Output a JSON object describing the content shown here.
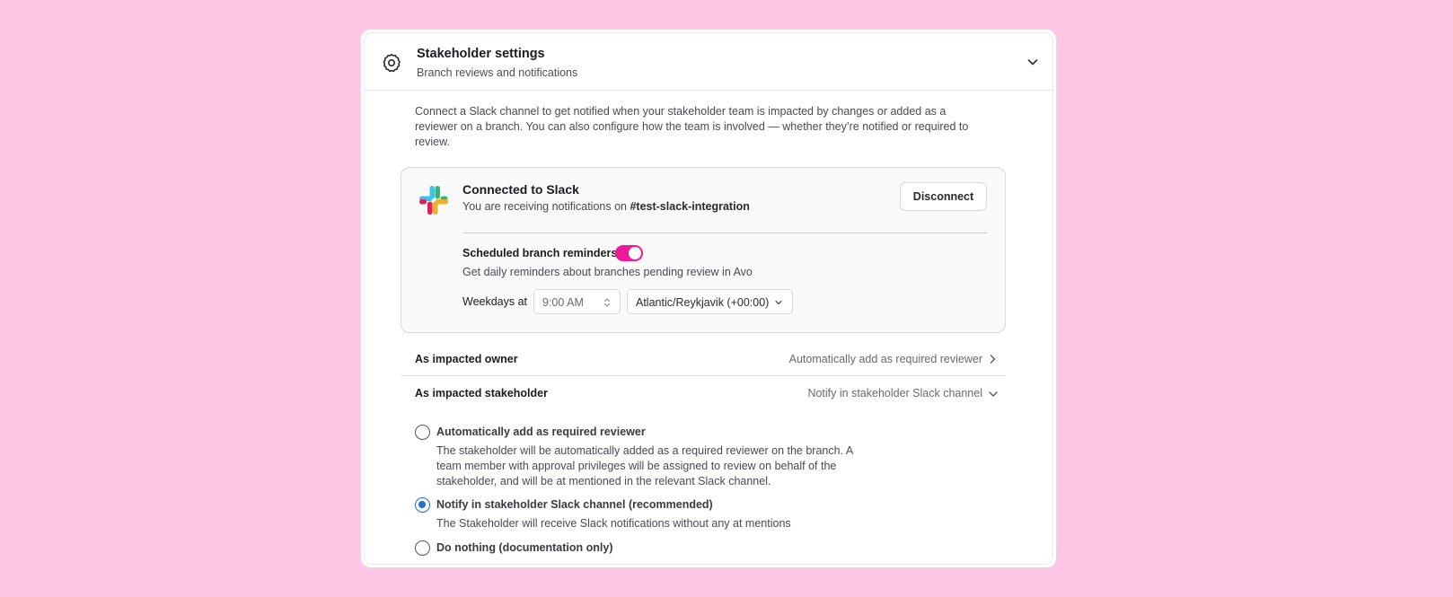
{
  "header": {
    "title": "Stakeholder settings",
    "subtitle": "Branch reviews and notifications",
    "icon": "gear-icon"
  },
  "intro": "Connect a Slack channel to get notified when your stakeholder team is impacted by changes or added as a reviewer on a branch. You can also configure how the team is involved — whether they’re notified or required to review.",
  "slack": {
    "title": "Connected to Slack",
    "subtitle_prefix": "You are receiving notifications on ",
    "channel": "#test-slack-integration",
    "disconnect_label": "Disconnect",
    "reminders_label": "Scheduled branch reminders",
    "reminders_enabled": true,
    "reminders_desc": "Get daily reminders about branches pending review in Avo",
    "weekdays_label": "Weekdays at",
    "time_value": "9:00 AM",
    "timezone_value": "Atlantic/Reykjavik (+00:00)",
    "toggle_color": "#f0199a"
  },
  "owner": {
    "title": "As impacted owner",
    "value": "Automatically add as required reviewer"
  },
  "stakeholder": {
    "title": "As impacted stakeholder",
    "value": "Notify in stakeholder Slack channel",
    "options": [
      {
        "label": "Automatically add as required reviewer",
        "desc": "The stakeholder will be automatically added as a required reviewer on the branch. A team member with approval privileges will be assigned to review on behalf of the stakeholder, and will be at mentioned in the relevant Slack channel.",
        "selected": false
      },
      {
        "label": "Notify in stakeholder Slack channel (recommended)",
        "desc": "The Stakeholder will receive Slack notifications without any at mentions",
        "selected": true
      },
      {
        "label": "Do nothing (documentation only)",
        "desc": "",
        "selected": false
      }
    ]
  },
  "colors": {
    "background": "#ffc7e6",
    "accent": "#1f6fd6"
  }
}
